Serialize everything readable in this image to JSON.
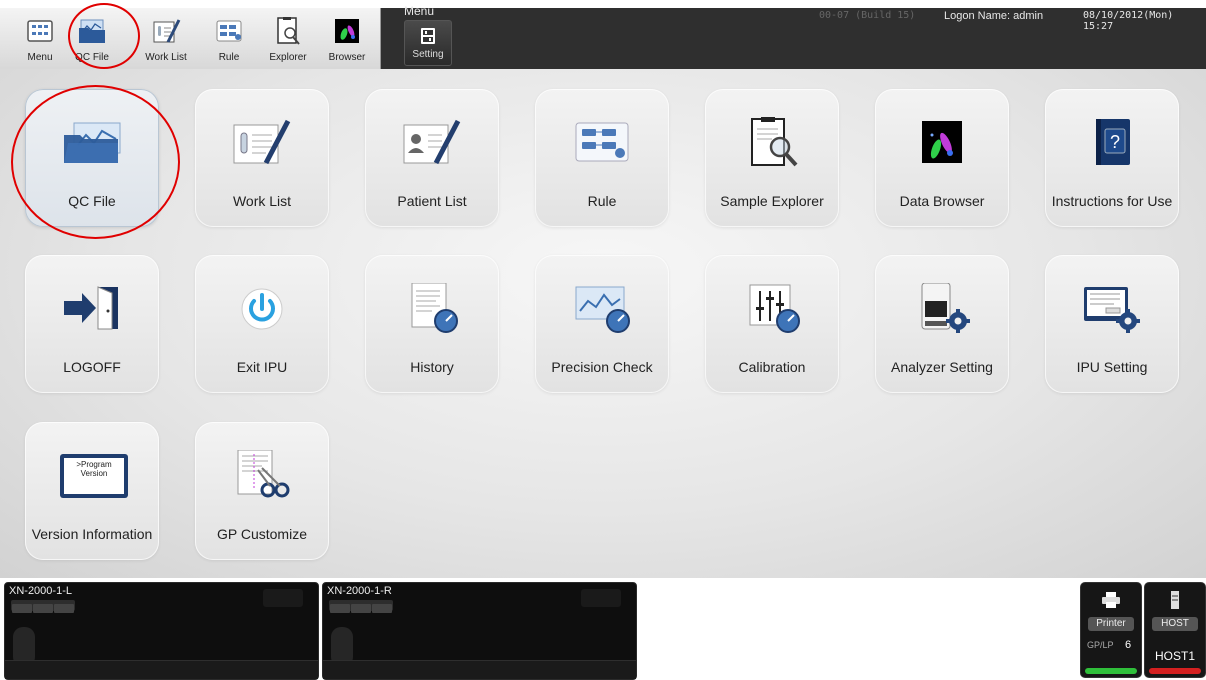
{
  "toolbar": {
    "shortcuts": [
      {
        "label": "Menu",
        "icon": "menu-grid-icon"
      },
      {
        "label": "QC File",
        "icon": "qc-file-icon"
      },
      {
        "label": "Work List",
        "icon": "work-list-icon"
      },
      {
        "label": "Rule",
        "icon": "rule-icon"
      },
      {
        "label": "Explorer",
        "icon": "explorer-icon"
      },
      {
        "label": "Browser",
        "icon": "browser-icon"
      }
    ],
    "menu_label": "Menu",
    "setting_label": "Setting",
    "build": "00-07 (Build 15)",
    "logon": "Logon Name: admin",
    "datetime": "08/10/2012(Mon) 15:27"
  },
  "tiles": [
    {
      "label": "QC File",
      "icon": "qc-file-icon",
      "selected": true
    },
    {
      "label": "Work List",
      "icon": "work-list-icon"
    },
    {
      "label": "Patient List",
      "icon": "patient-list-icon"
    },
    {
      "label": "Rule",
      "icon": "rule-icon"
    },
    {
      "label": "Sample Explorer",
      "icon": "sample-explorer-icon"
    },
    {
      "label": "Data Browser",
      "icon": "data-browser-icon"
    },
    {
      "label": "Instructions for Use",
      "icon": "help-book-icon"
    },
    {
      "label": "LOGOFF",
      "icon": "logoff-door-icon"
    },
    {
      "label": "Exit IPU",
      "icon": "power-icon"
    },
    {
      "label": "History",
      "icon": "history-icon"
    },
    {
      "label": "Precision Check",
      "icon": "precision-check-icon"
    },
    {
      "label": "Calibration",
      "icon": "calibration-icon"
    },
    {
      "label": "Analyzer Setting",
      "icon": "analyzer-setting-icon"
    },
    {
      "label": "IPU Setting",
      "icon": "ipu-setting-icon"
    },
    {
      "label": "Version Information",
      "icon": "version-info-icon",
      "icon_text": ">Program Version"
    },
    {
      "label": "GP Customize",
      "icon": "gp-customize-icon"
    }
  ],
  "analyzers": [
    {
      "name": "XN-2000-1-L"
    },
    {
      "name": "XN-2000-1-R"
    }
  ],
  "printer": {
    "label": "Printer",
    "sub": "GP/LP",
    "count": "6",
    "status_color": "#2fbf3a"
  },
  "host": {
    "label": "HOST",
    "name": "HOST1",
    "status_color": "#d42020"
  },
  "colors": {
    "highlight": "#e00000",
    "topbar": "#2f2f2f"
  }
}
